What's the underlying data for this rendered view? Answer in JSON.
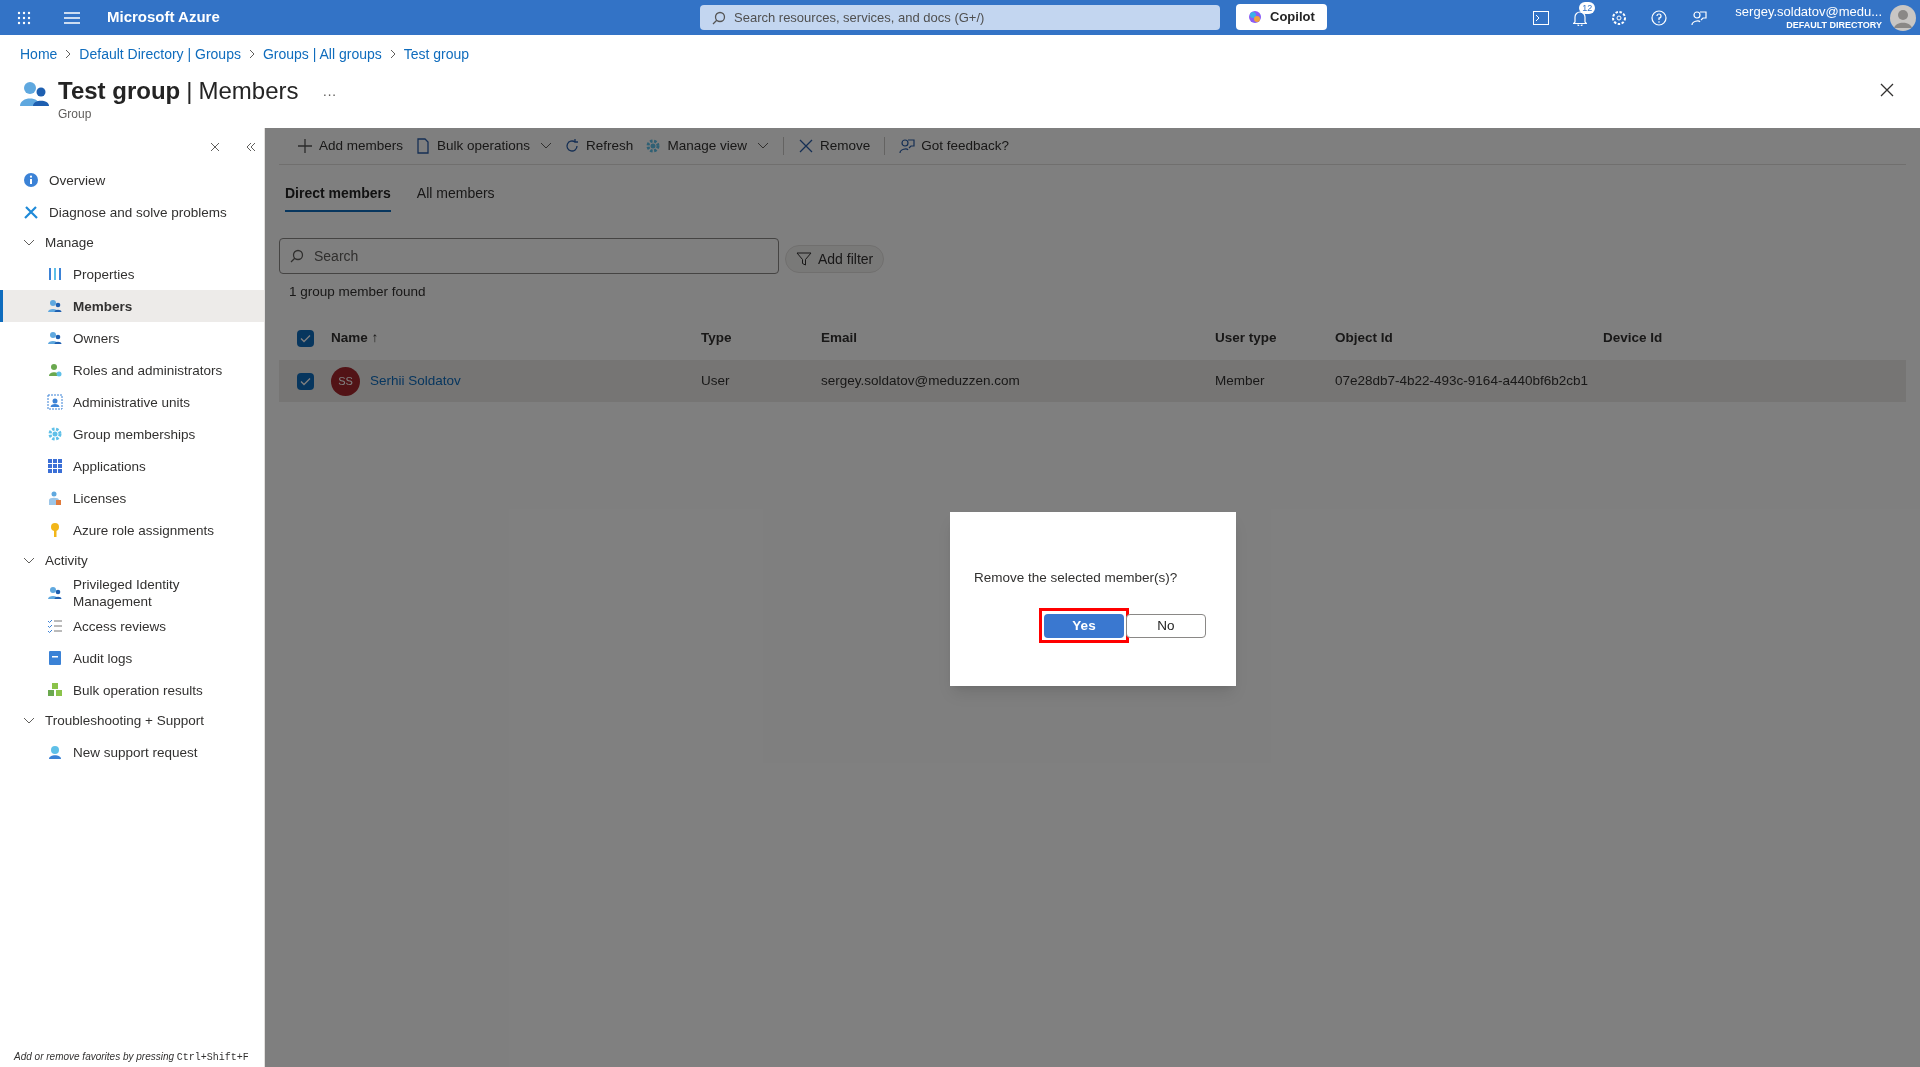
{
  "topbar": {
    "brand": "Microsoft Azure",
    "search_placeholder": "Search resources, services, and docs (G+/)",
    "copilot": "Copilot",
    "notification_count": "12",
    "account_name": "sergey.soldatov@medu...",
    "account_directory": "DEFAULT DIRECTORY"
  },
  "breadcrumb": [
    "Home",
    "Default Directory | Groups",
    "Groups | All groups",
    "Test group"
  ],
  "header": {
    "title": "Test group",
    "separator": "|",
    "section": "Members",
    "more": "···",
    "subtitle": "Group"
  },
  "sidebar": [
    {
      "kind": "link",
      "label": "Overview",
      "selected": false
    },
    {
      "kind": "link",
      "label": "Diagnose and solve problems",
      "selected": false
    },
    {
      "kind": "group",
      "label": "Manage",
      "expanded": true,
      "children": [
        {
          "label": "Properties",
          "selected": false
        },
        {
          "label": "Members",
          "selected": true
        },
        {
          "label": "Owners",
          "selected": false
        },
        {
          "label": "Roles and administrators",
          "selected": false
        },
        {
          "label": "Administrative units",
          "selected": false
        },
        {
          "label": "Group memberships",
          "selected": false
        },
        {
          "label": "Applications",
          "selected": false
        },
        {
          "label": "Licenses",
          "selected": false
        },
        {
          "label": "Azure role assignments",
          "selected": false
        }
      ]
    },
    {
      "kind": "group",
      "label": "Activity",
      "expanded": true,
      "children": [
        {
          "label": "Privileged Identity Management",
          "selected": false
        },
        {
          "label": "Access reviews",
          "selected": false
        },
        {
          "label": "Audit logs",
          "selected": false
        },
        {
          "label": "Bulk operation results",
          "selected": false
        }
      ]
    },
    {
      "kind": "group",
      "label": "Troubleshooting + Support",
      "expanded": true,
      "children": [
        {
          "label": "New support request",
          "selected": false
        }
      ]
    }
  ],
  "favorites_hint": {
    "text": "Add or remove favorites by pressing",
    "shortcut": "Ctrl+Shift+F"
  },
  "toolbar": [
    {
      "label": "Add members",
      "dropdown": false
    },
    {
      "label": "Bulk operations",
      "dropdown": true
    },
    {
      "label": "Refresh",
      "dropdown": false
    },
    {
      "label": "Manage view",
      "dropdown": true
    },
    {
      "label": "Remove",
      "dropdown": false
    },
    {
      "label": "Got feedback?",
      "dropdown": false
    }
  ],
  "tabs": [
    {
      "label": "Direct members",
      "selected": true
    },
    {
      "label": "All members",
      "selected": false
    }
  ],
  "search_placeholder": "Search",
  "filter_button": "Add filter",
  "result_count": "1 group member found",
  "table": {
    "all_selected": true,
    "columns": [
      "Name ↑",
      "Type",
      "Email",
      "User type",
      "Object Id",
      "Device Id"
    ],
    "rows": [
      {
        "selected": true,
        "initials": "SS",
        "name": "Serhii Soldatov",
        "type": "User",
        "email": "sergey.soldatov@meduzzen.com",
        "user_type": "Member",
        "object_id": "07e28db7-4b22-493c-9164-a440bf6b2cb1"
      }
    ]
  },
  "dialog": {
    "message": "Remove the selected member(s)?",
    "buttons": [
      {
        "label": "Yes",
        "primary": true,
        "highlighted": true
      },
      {
        "label": "No",
        "primary": false,
        "highlighted": false
      }
    ]
  }
}
